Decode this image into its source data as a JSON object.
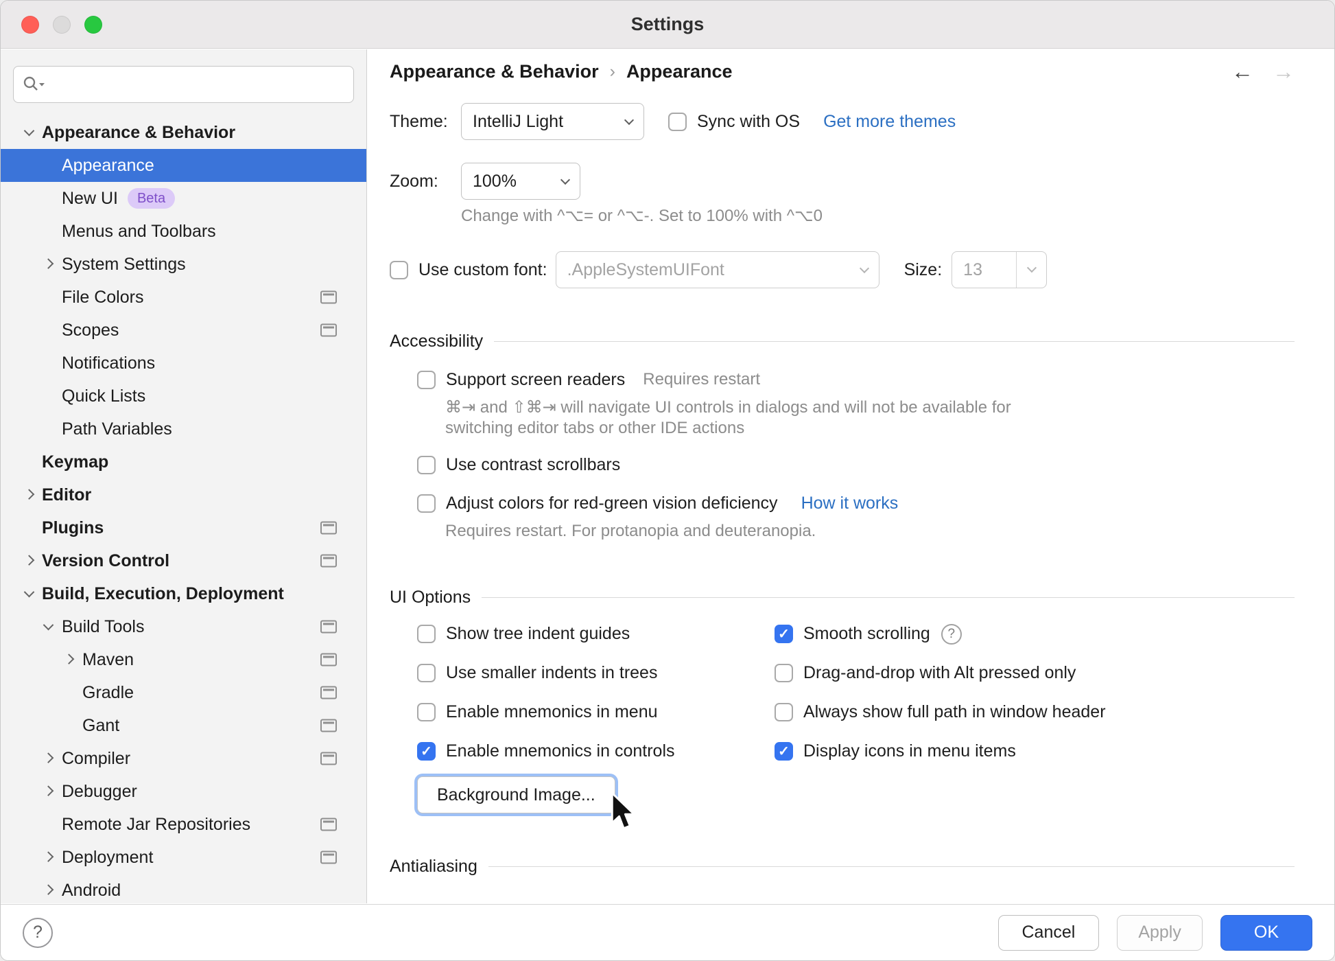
{
  "colors": {
    "accent": "#3574f0",
    "selection": "#3b74d9",
    "link": "#2b6fc2",
    "hint": "#8c8c8c",
    "badge-bg": "#dccaf8",
    "badge-text": "#7e4fc9",
    "focus-ring": "#9dc0f6"
  },
  "window": {
    "title": "Settings"
  },
  "sidebar": {
    "search": {
      "placeholder": ""
    },
    "items": [
      {
        "label": "Appearance & Behavior"
      },
      {
        "label": "Appearance"
      },
      {
        "label": "New UI",
        "badge": "Beta"
      },
      {
        "label": "Menus and Toolbars"
      },
      {
        "label": "System Settings"
      },
      {
        "label": "File Colors"
      },
      {
        "label": "Scopes"
      },
      {
        "label": "Notifications"
      },
      {
        "label": "Quick Lists"
      },
      {
        "label": "Path Variables"
      },
      {
        "label": "Keymap"
      },
      {
        "label": "Editor"
      },
      {
        "label": "Plugins"
      },
      {
        "label": "Version Control"
      },
      {
        "label": "Build, Execution, Deployment"
      },
      {
        "label": "Build Tools"
      },
      {
        "label": "Maven"
      },
      {
        "label": "Gradle"
      },
      {
        "label": "Gant"
      },
      {
        "label": "Compiler"
      },
      {
        "label": "Debugger"
      },
      {
        "label": "Remote Jar Repositories"
      },
      {
        "label": "Deployment"
      },
      {
        "label": "Android"
      }
    ]
  },
  "header": {
    "breadcrumb1": "Appearance & Behavior",
    "separator": "›",
    "breadcrumb2": "Appearance",
    "back": "←",
    "forward": "→"
  },
  "theme": {
    "label": "Theme:",
    "value": "IntelliJ Light",
    "sync_label": "Sync with OS",
    "sync_checked": false,
    "link": "Get more themes"
  },
  "zoom": {
    "label": "Zoom:",
    "value": "100%",
    "hint": "Change with ^⌥= or ^⌥-. Set to 100% with ^⌥0"
  },
  "custom_font": {
    "checked": false,
    "label": "Use custom font:",
    "font": ".AppleSystemUIFont",
    "size_label": "Size:",
    "size": "13"
  },
  "accessibility": {
    "title": "Accessibility",
    "screen_readers": {
      "label": "Support screen readers",
      "checked": false,
      "note": "Requires restart",
      "hint": "⌘⇥ and ⇧⌘⇥ will navigate UI controls in dialogs and will not be available for switching editor tabs or other IDE actions"
    },
    "contrast": {
      "label": "Use contrast scrollbars",
      "checked": false
    },
    "red_green": {
      "label": "Adjust colors for red-green vision deficiency",
      "checked": false,
      "link": "How it works",
      "hint": "Requires restart. For protanopia and deuteranopia."
    }
  },
  "ui_options": {
    "title": "UI Options",
    "left": [
      {
        "label": "Show tree indent guides",
        "checked": false
      },
      {
        "label": "Use smaller indents in trees",
        "checked": false
      },
      {
        "label": "Enable mnemonics in menu",
        "checked": false
      },
      {
        "label": "Enable mnemonics in controls",
        "checked": true
      }
    ],
    "right": [
      {
        "label": "Smooth scrolling",
        "checked": true,
        "help": "?"
      },
      {
        "label": "Drag-and-drop with Alt pressed only",
        "checked": false
      },
      {
        "label": "Always show full path in window header",
        "checked": false
      },
      {
        "label": "Display icons in menu items",
        "checked": true
      }
    ],
    "background_button": "Background Image..."
  },
  "antialiasing": {
    "title": "Antialiasing"
  },
  "footer": {
    "help": "?",
    "cancel": "Cancel",
    "apply": "Apply",
    "ok": "OK"
  }
}
